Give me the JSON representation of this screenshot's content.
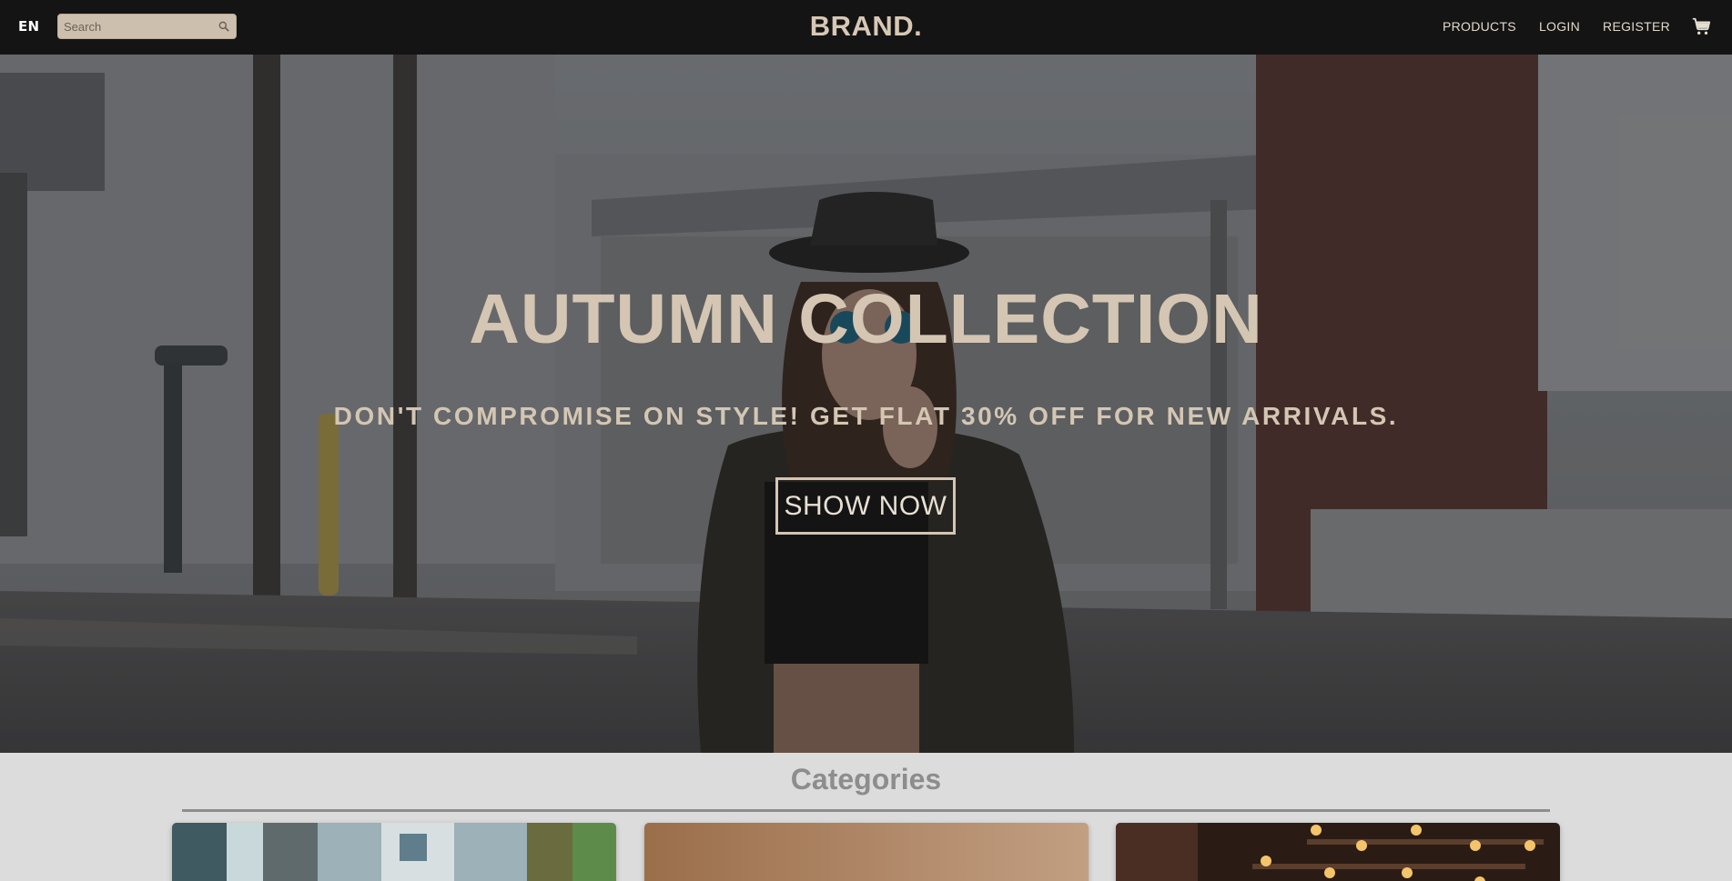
{
  "header": {
    "language": "EN",
    "search": {
      "placeholder": "Search",
      "value": ""
    },
    "brand": "BRAND.",
    "nav": [
      {
        "label": "PRODUCTS"
      },
      {
        "label": "LOGIN"
      },
      {
        "label": "REGISTER"
      }
    ],
    "cart_icon": "shopping-cart-icon",
    "search_icon": "search-icon"
  },
  "hero": {
    "title": "AUTUMN COLLECTION",
    "subtitle": "DON'T COMPROMISE ON STYLE! GET FLAT 30% OFF FOR NEW ARRIVALS.",
    "button_label": "SHOW NOW"
  },
  "categories": {
    "title": "Categories"
  },
  "colors": {
    "navbar_bg": "#141414",
    "accent_beige": "#d4c6b3",
    "page_bg": "#dcdcdc"
  }
}
